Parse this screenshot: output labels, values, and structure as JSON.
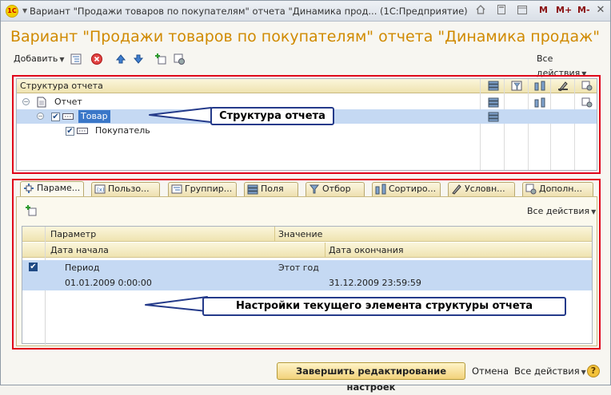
{
  "window": {
    "title": "Вариант \"Продажи товаров по покупателям\" отчета \"Динамика прод...  (1С:Предприятие)",
    "logo_text": "1С",
    "title_buttons": [
      "M",
      "M+",
      "M-"
    ],
    "close_glyph": "✕"
  },
  "header": {
    "title": "Вариант \"Продажи товаров по покупателям\" отчета \"Динамика продаж\""
  },
  "toolbar": {
    "add_label": "Добавить",
    "all_actions": "Все действия"
  },
  "structure": {
    "header": "Структура отчета",
    "items": [
      {
        "label": "Отчет",
        "level": 0
      },
      {
        "label": "Товар",
        "level": 1
      },
      {
        "label": "Покупатель",
        "level": 2
      }
    ],
    "callout": "Структура отчета"
  },
  "tabs": [
    {
      "label": "Параме...",
      "icon": "parameters-icon"
    },
    {
      "label": "Пользо...",
      "icon": "user-fields-icon"
    },
    {
      "label": "Группир...",
      "icon": "grouping-icon"
    },
    {
      "label": "Поля",
      "icon": "fields-icon"
    },
    {
      "label": "Отбор",
      "icon": "filter-icon"
    },
    {
      "label": "Сортиро...",
      "icon": "sort-icon"
    },
    {
      "label": "Условн...",
      "icon": "conditional-format-icon"
    },
    {
      "label": "Дополн...",
      "icon": "additional-icon"
    }
  ],
  "settings": {
    "all_actions": "Все действия",
    "columns": {
      "param": "Параметр",
      "value": "Значение",
      "start": "Дата начала",
      "end": "Дата окончания"
    },
    "row": {
      "checked": true,
      "param": "Период",
      "value": "Этот год",
      "start": "01.01.2009 0:00:00",
      "end": "31.12.2009 23:59:59"
    },
    "callout": "Настройки текущего элемента структуры отчета"
  },
  "footer": {
    "finish_label": "Завершить редактирование настроек",
    "cancel_label": "Отмена",
    "all_actions": "Все действия",
    "help_label": "?"
  },
  "colors": {
    "accent_title": "#d08a00",
    "highlight_frame": "#e0001a",
    "callout_border": "#243a8a",
    "selection": "#c5d9f3"
  }
}
